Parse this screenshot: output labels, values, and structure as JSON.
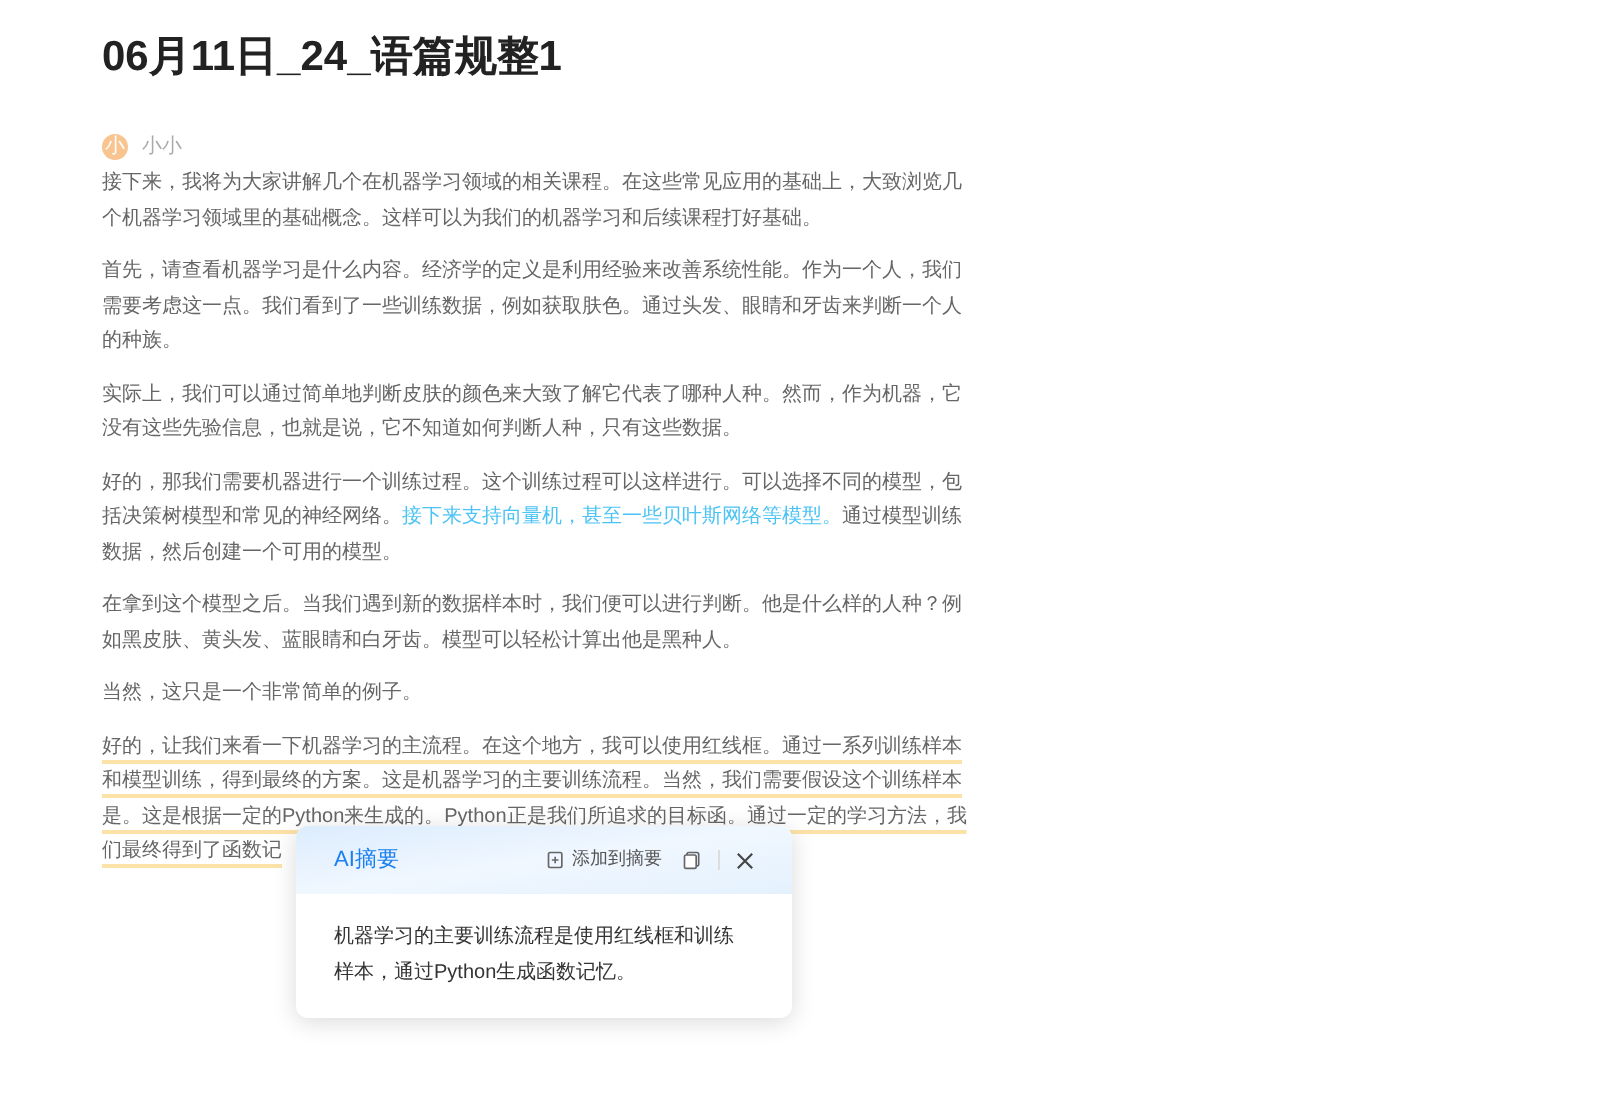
{
  "title": "06月11日_24_语篇规整1",
  "author": {
    "avatar": "小",
    "name": "小小"
  },
  "paragraphs": [
    {
      "highlighted": false,
      "segments": [
        {
          "kind": "text",
          "text": "接下来，我将为大家讲解几个在机器学习领域的相关课程。在这些常见应用的基础上，大致浏览几个机器学习领域里的基础概念。这样可以为我们的机器学习和后续课程打好基础。"
        }
      ]
    },
    {
      "highlighted": false,
      "segments": [
        {
          "kind": "text",
          "text": "首先，请查看机器学习是什么内容。经济学的定义是利用经验来改善系统性能。作为一个人，我们需要考虑这一点。我们看到了一些训练数据，例如获取肤色。通过头发、眼睛和牙齿来判断一个人的种族。"
        }
      ]
    },
    {
      "highlighted": false,
      "segments": [
        {
          "kind": "text",
          "text": "实际上，我们可以通过简单地判断皮肤的颜色来大致了解它代表了哪种人种。然而，作为机器，它没有这些先验信息，也就是说，它不知道如何判断人种，只有这些数据。"
        }
      ]
    },
    {
      "highlighted": false,
      "segments": [
        {
          "kind": "text",
          "text": "好的，那我们需要机器进行一个训练过程。这个训练过程可以这样进行。可以选择不同的模型，包括决策树模型和常见的神经网络。"
        },
        {
          "kind": "link",
          "text": "接下来支持向量机，甚至一些贝叶斯网络等模型。"
        },
        {
          "kind": "text",
          "text": "通过模型训练数据，然后创建一个可用的模型。"
        }
      ]
    },
    {
      "highlighted": false,
      "segments": [
        {
          "kind": "text",
          "text": "在拿到这个模型之后。当我们遇到新的数据样本时，我们便可以进行判断。他是什么样的人种？例如黑皮肤、黄头发、蓝眼睛和白牙齿。模型可以轻松计算出他是黑种人。"
        }
      ]
    },
    {
      "highlighted": false,
      "segments": [
        {
          "kind": "text",
          "text": "当然，这只是一个非常简单的例子。"
        }
      ]
    },
    {
      "highlighted": true,
      "segments": [
        {
          "kind": "block",
          "text": "好的，让我们来看一下机器学习的主流程。在这个地方，我可以使用红线框。通过一系列训练样本和模型训练，得到最终的方案。这是机器学习的主要训练流程。当然，我们需要假设这个训练样本是。这是根据一定的Python来生成的。Python正是我们所追求的目标函。通过一定的学习方法，我"
        },
        {
          "kind": "block",
          "text": "们最终得到了函数记"
        }
      ]
    }
  ],
  "popup": {
    "title": "AI摘要",
    "add_label": "添加到摘要",
    "summary": "机器学习的主要训练流程是使用红线框和训练样本，通过Python生成函数记忆。"
  }
}
